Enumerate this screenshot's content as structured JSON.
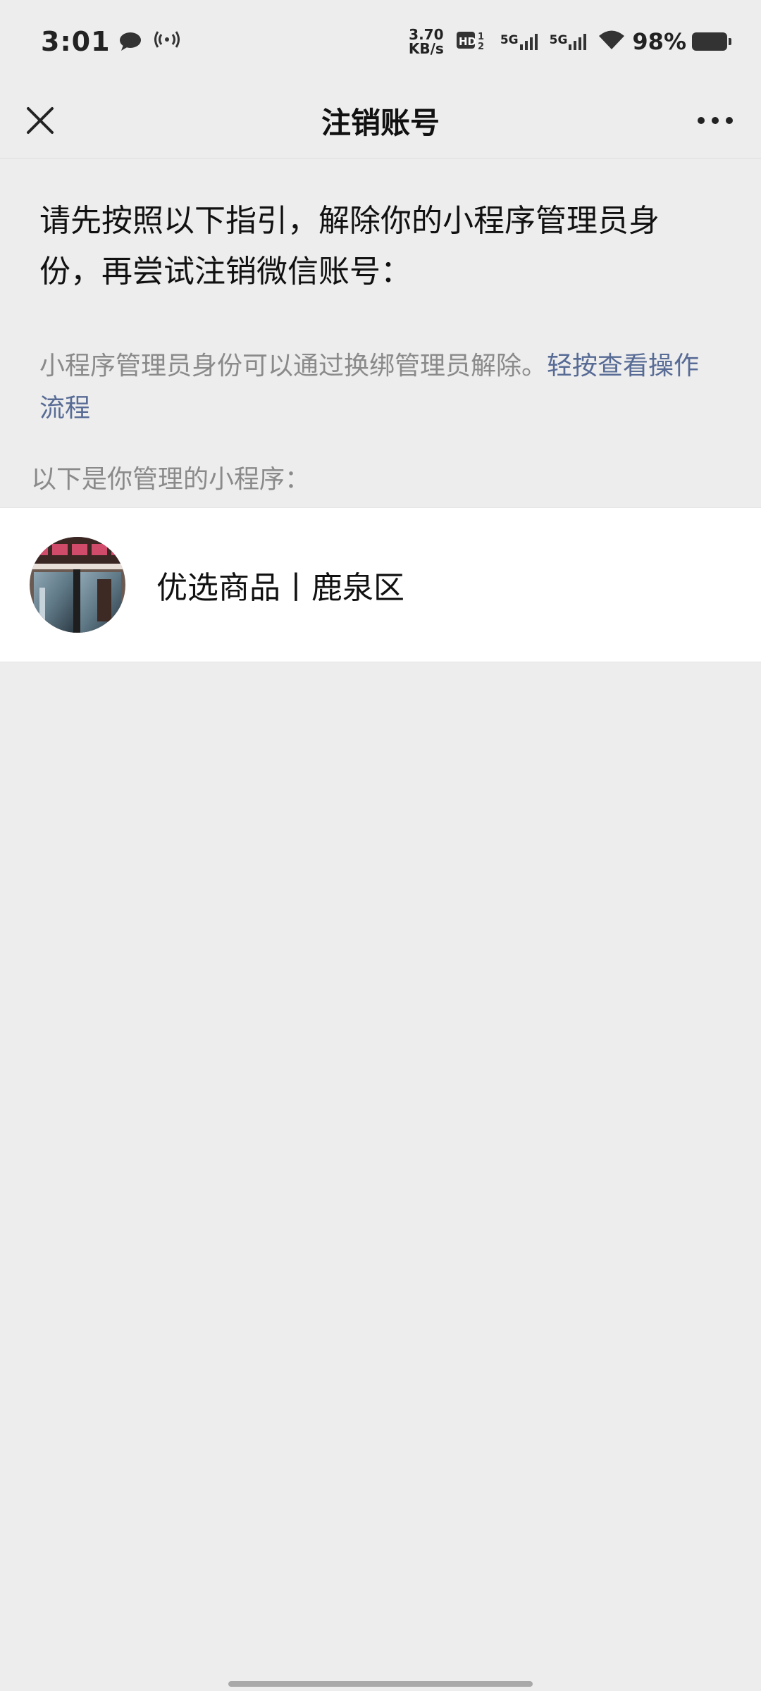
{
  "status_bar": {
    "time": "3:01",
    "speed_value": "3.70",
    "speed_unit": "KB/s",
    "network_1": "5G",
    "network_2": "5G",
    "battery": "98%"
  },
  "header": {
    "title": "注销账号",
    "close_icon": "close-icon",
    "more_icon": "more-icon"
  },
  "content": {
    "instruction": "请先按照以下指引，解除你的小程序管理员身份，再尝试注销微信账号：",
    "note_text": "小程序管理员身份可以通过换绑管理员解除。",
    "note_link": "轻按查看操作流程",
    "section_label": "以下是你管理的小程序："
  },
  "mini_programs": [
    {
      "name": "优选商品丨鹿泉区",
      "avatar": "storefront-photo"
    }
  ],
  "colors": {
    "background": "#ededed",
    "link": "#576b95",
    "secondary_text": "#8a8a8a"
  }
}
